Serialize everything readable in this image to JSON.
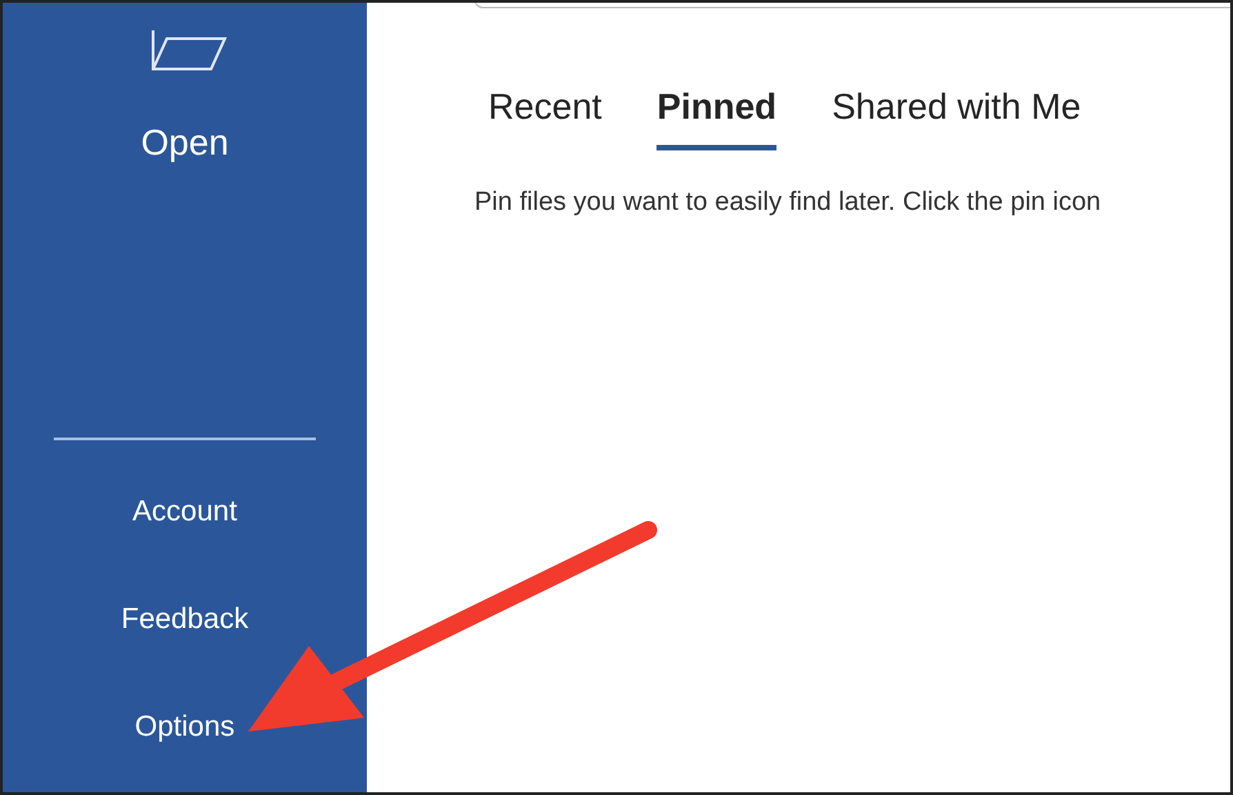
{
  "sidebar": {
    "open_label": "Open",
    "items": [
      {
        "label": "Account"
      },
      {
        "label": "Feedback"
      },
      {
        "label": "Options"
      }
    ]
  },
  "tabs": [
    {
      "label": "Recent",
      "selected": false
    },
    {
      "label": "Pinned",
      "selected": true
    },
    {
      "label": "Shared with Me",
      "selected": false
    }
  ],
  "hint": "Pin files you want to easily find later. Click the pin icon"
}
